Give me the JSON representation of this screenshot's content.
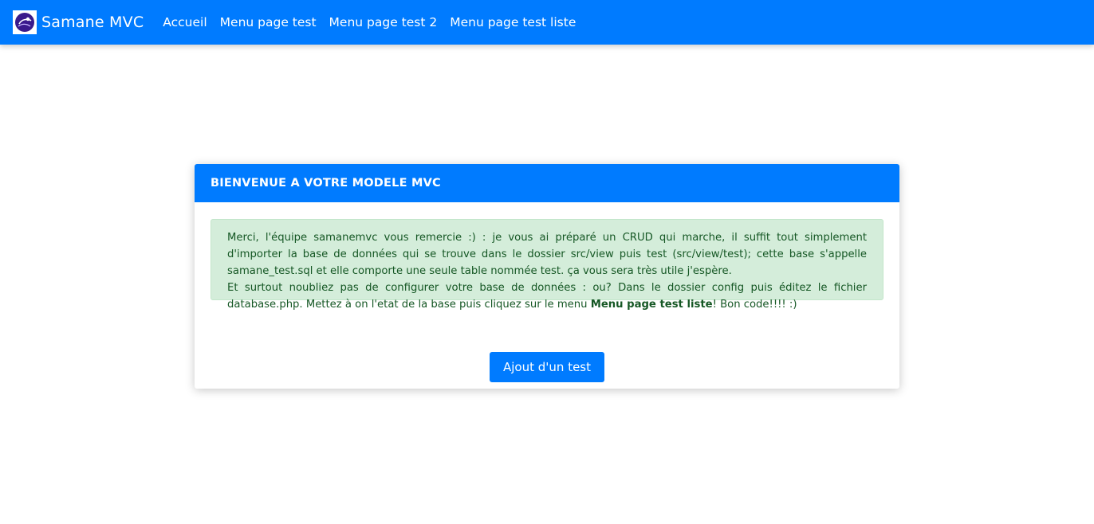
{
  "app": {
    "brand": "Samane MVC",
    "logo_icon": "samane-logo-icon"
  },
  "nav": {
    "items": [
      {
        "label": "Accueil"
      },
      {
        "label": "Menu page test"
      },
      {
        "label": "Menu page test 2"
      },
      {
        "label": "Menu page test liste"
      }
    ]
  },
  "card": {
    "title": "BIENVENUE A VOTRE MODELE MVC",
    "alert": {
      "line1": "Merci, l'équipe samanemvc vous remercie :) : je vous ai préparé un CRUD qui marche, il suffit tout simplement d'importer la base de données qui se trouve dans le dossier src/view puis test (src/view/test); cette base s'appelle samane_test.sql et elle comporte une seule table nommée test. ça vous sera très utile j'espère.",
      "line2_before": "Et surtout noubliez pas de configurer votre base de données : ou? Dans le dossier config puis éditez le fichier database.php. Mettez à on l'etat de la base puis cliquez sur le menu ",
      "line2_bold": "Menu page test liste",
      "line2_after": "! Bon code!!!! :)"
    },
    "button_label": "Ajout d'un test"
  },
  "colors": {
    "primary": "#007bff",
    "alert_bg": "#d4edda",
    "alert_text": "#155724"
  }
}
